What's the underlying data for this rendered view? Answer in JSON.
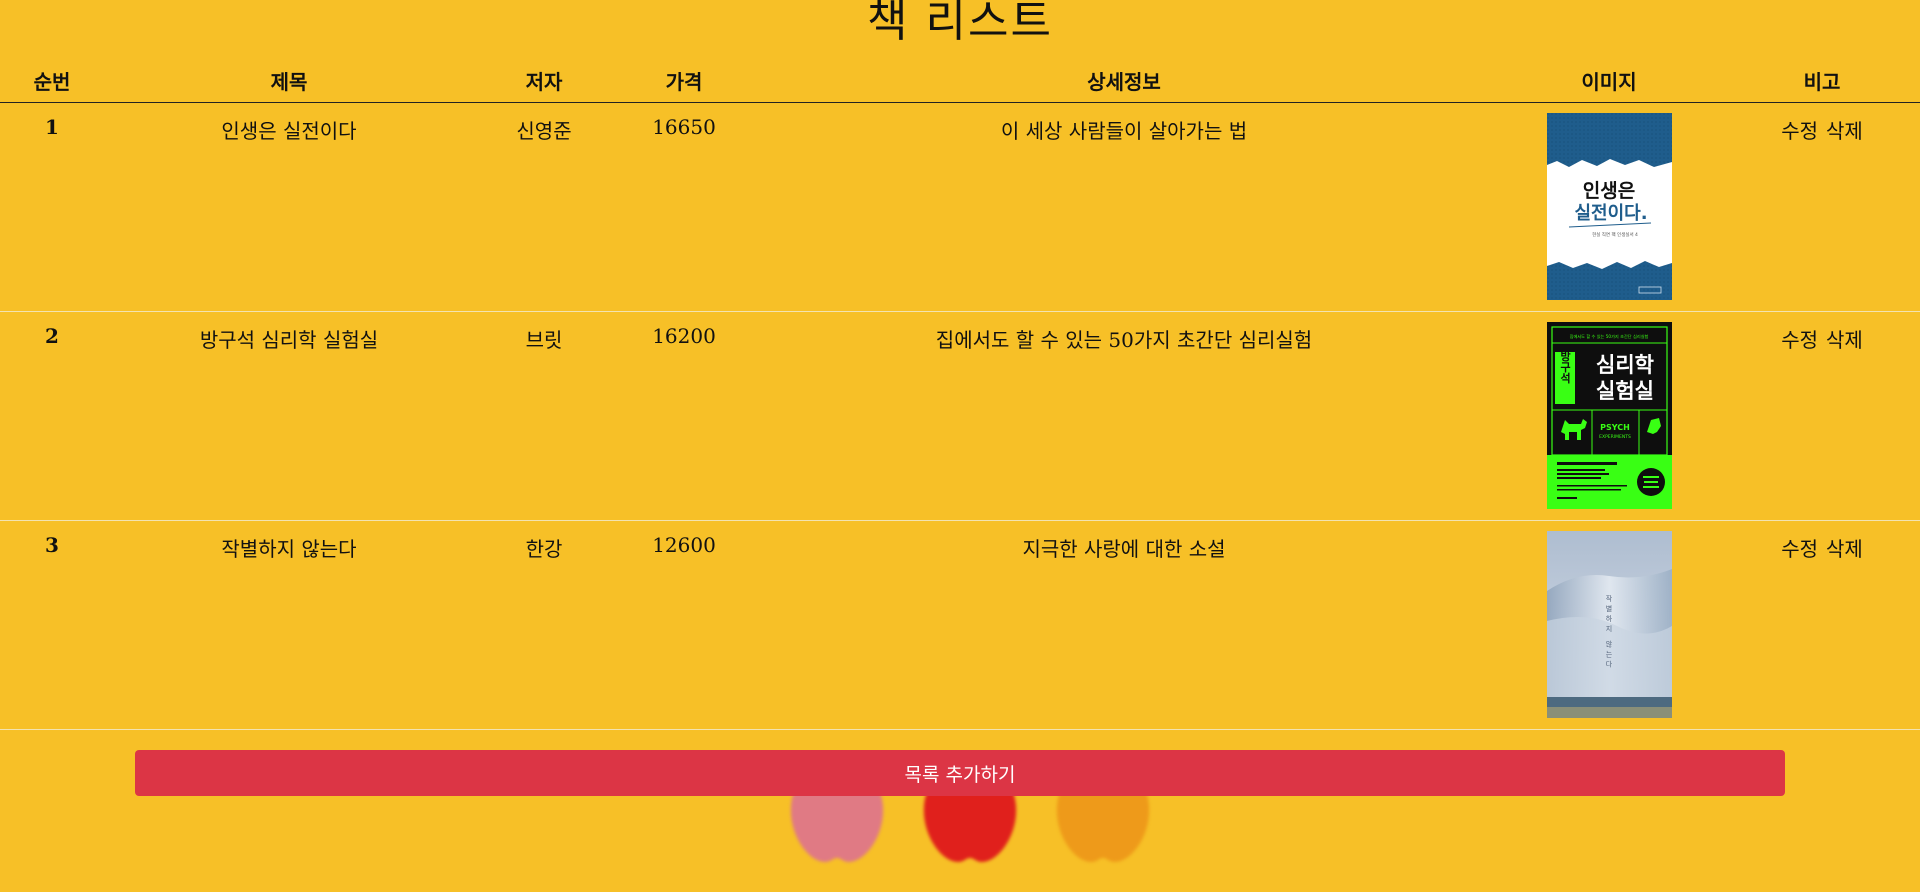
{
  "page": {
    "title": "책 리스트"
  },
  "table": {
    "headers": {
      "num": "순번",
      "title": "제목",
      "author": "저자",
      "price": "가격",
      "detail": "상세정보",
      "image": "이미지",
      "note": "비고"
    },
    "rows": [
      {
        "num": "1",
        "title": "인생은 실전이다",
        "author": "신영준",
        "price": "16650",
        "detail": "이 세상 사람들이 살아가는 법",
        "edit": "수정",
        "delete": "삭제",
        "cover": {
          "top_text": "인생은",
          "mid_text": "실전이다.",
          "sub_text": "현실 직면 팩 인생실서 4",
          "colors": {
            "background": "#1f5d8c",
            "paper": "#ffffff",
            "accent": "#1f5d8c",
            "text": "#111111"
          }
        }
      },
      {
        "num": "2",
        "title": "방구석 심리학 실험실",
        "author": "브릿",
        "price": "16200",
        "detail": "집에서도 할 수 있는 50가지 초간단 심리실험",
        "edit": "수정",
        "delete": "삭제",
        "cover": {
          "top_text": "집에서도 할 수 있는 50가지 초간단 심리실험",
          "side_text": "방구석",
          "main_line1": "심리학",
          "main_line2": "실험실",
          "psych_line1": "PSYCH",
          "psych_line2": "EXPERIMENTS",
          "colors": {
            "background": "#0e0e0e",
            "green": "#39ff14",
            "text": "#ffffff"
          }
        }
      },
      {
        "num": "3",
        "title": "작별하지 않는다",
        "author": "한강",
        "price": "12600",
        "detail": "지극한 사랑에 대한 소설",
        "edit": "수정",
        "delete": "삭제",
        "cover": {
          "vertical_text": "작별하지 않는다",
          "colors": {
            "sky": "#b8c6d8",
            "wave": "#dfe6ee",
            "sea": "#4d6a80"
          }
        }
      }
    ]
  },
  "add_button": {
    "label": "목록 추가하기",
    "color": "#dc3545"
  },
  "decor": {
    "apple_colors": [
      "#e07a84",
      "#e0201c",
      "#ee9a1a"
    ]
  }
}
